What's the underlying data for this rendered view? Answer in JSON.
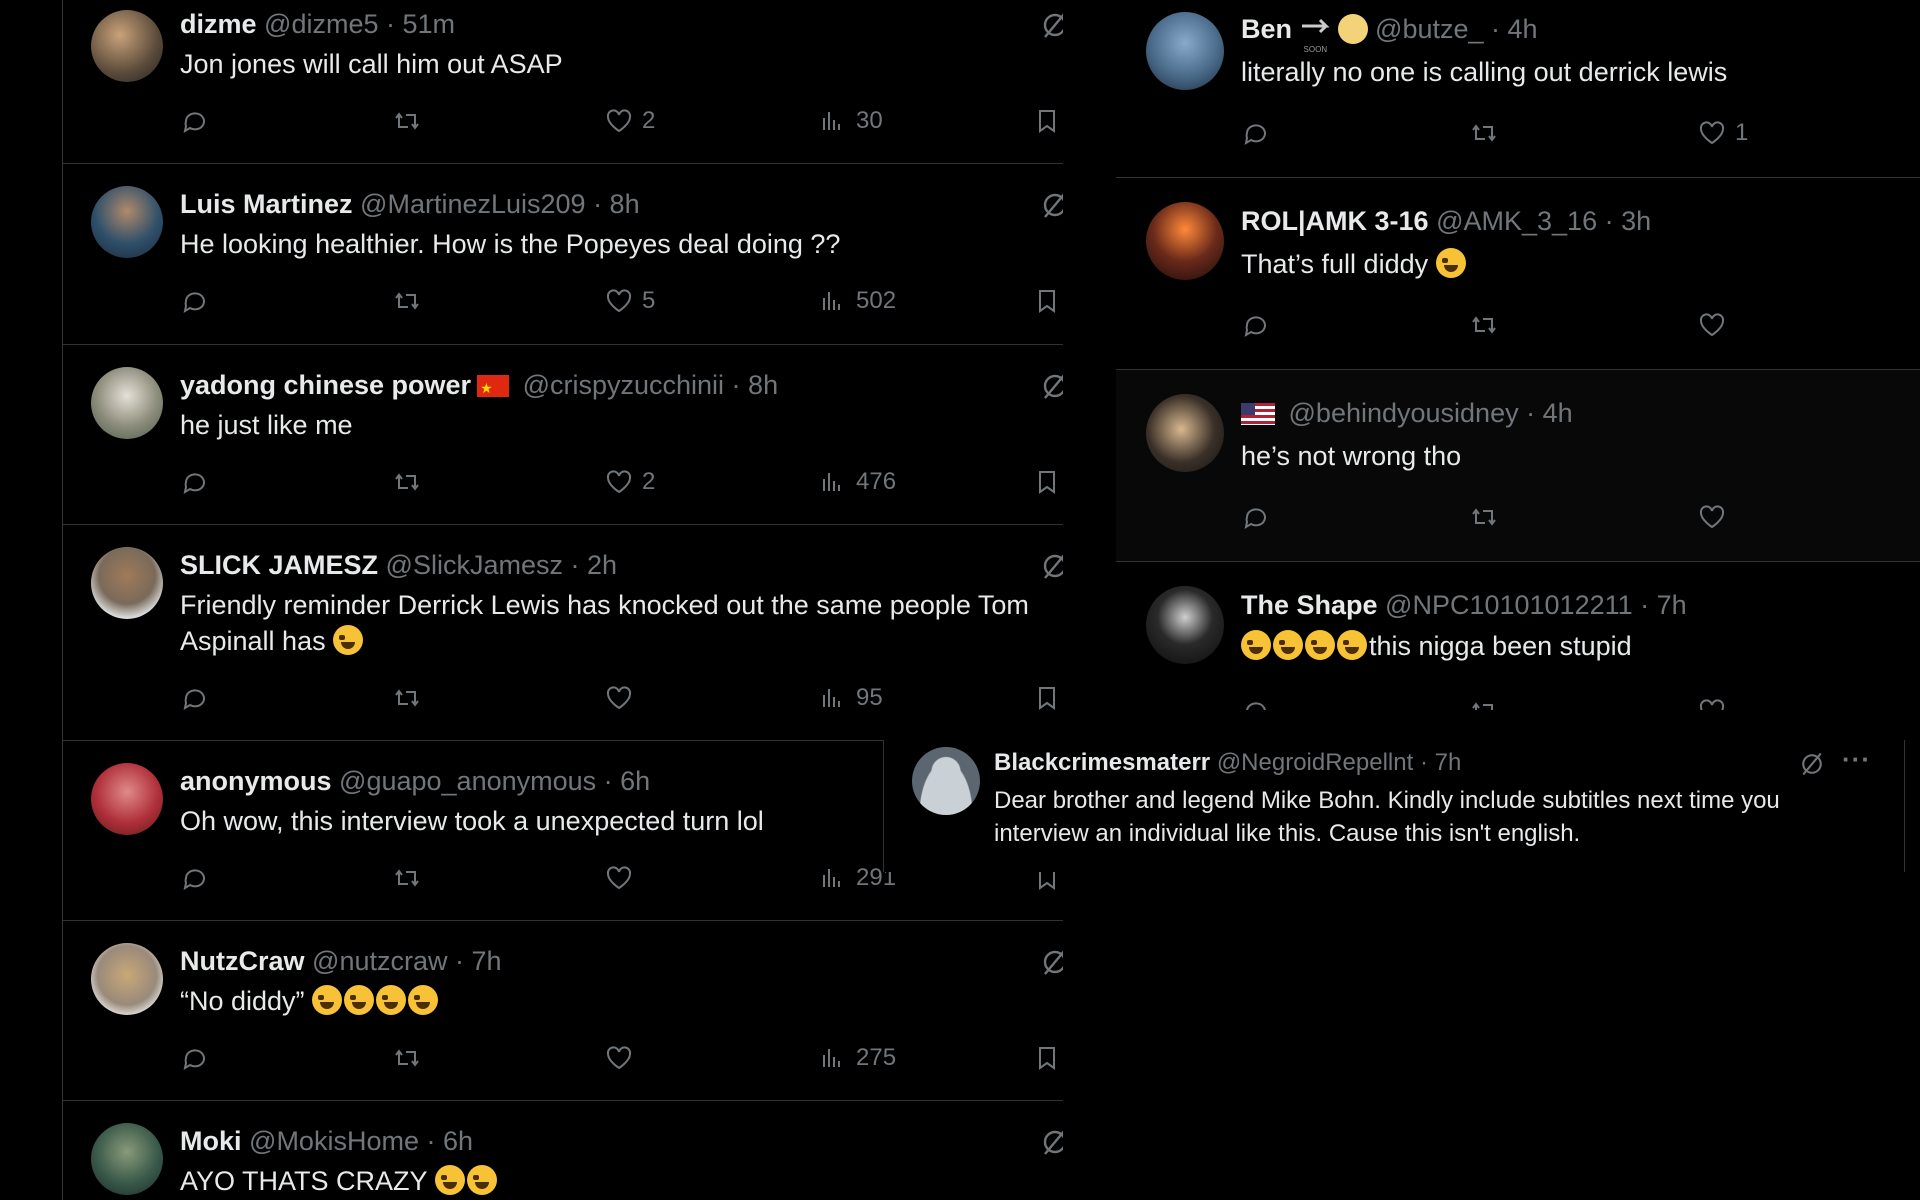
{
  "left_tweets": [
    {
      "name": "dizme",
      "handle": "@dizme5 · 51m",
      "text": "Jon jones will call him out ASAP",
      "likes": "2",
      "views": "30",
      "avatar_color": "#5a4a3a"
    },
    {
      "name": "Luis Martinez",
      "handle": "@MartinezLuis209 · 8h",
      "text": "He looking healthier. How is the Popeyes deal doing ??",
      "likes": "5",
      "views": "502",
      "avatar_color": "#2f4f6a"
    },
    {
      "name": "yadong chinese power",
      "handle": "@crispyzucchinii · 8h",
      "text": "he just like me",
      "likes": "2",
      "views": "476",
      "avatar_color": "#8c8c7a"
    },
    {
      "name": "SLICK JAMESZ",
      "handle": "@SlickJamesz · 2h",
      "text": "Friendly reminder Derrick Lewis has knocked out the same people Tom Aspinall has",
      "likes": "",
      "views": "95",
      "avatar_color": "#7a6a5a"
    },
    {
      "name": "anonymous",
      "handle": "@guapo_anonymous · 6h",
      "text": "Oh wow, this interview took a unexpected turn lol",
      "likes": "",
      "views": "291",
      "avatar_color": "#b0303a"
    },
    {
      "name": "NutzCraw",
      "handle": "@nutzcraw · 7h",
      "text": "“No diddy”",
      "likes": "",
      "views": "275",
      "avatar_color": "#9a8a7a"
    },
    {
      "name": "Moki",
      "handle": "@MokisHome · 6h",
      "text": "AYO THATS CRAZY",
      "avatar_color": "#3a5a4a"
    }
  ],
  "right_tweets": [
    {
      "name": "Ben",
      "handle": "@butze_ · 4h",
      "badge": "SOON",
      "text": "literally no one is calling out derrick lewis",
      "likes": "1",
      "avatar_color": "#4a6a8a"
    },
    {
      "name": "ROL|AMK 3-16",
      "handle": "@AMK_3_16 · 3h",
      "text": "That’s full diddy",
      "avatar_color": "#6a2a1a"
    },
    {
      "name": "",
      "handle": "@behindyousidney · 4h",
      "text": "he’s not wrong tho",
      "avatar_color": "#3a3028"
    },
    {
      "name": "The Shape",
      "handle": "@NPC10101012211 · 7h",
      "text": "this nigga been stupid",
      "avatar_color": "#2a2a2a"
    }
  ],
  "overlay_tweet": {
    "name": "Blackcrimesmaterr",
    "handle": "@NegroidRepellnt · 7h",
    "text": "Dear brother and legend Mike Bohn. Kindly include subtitles next time you interview an individual like this. Cause this isn't english."
  },
  "colors": {
    "background": "#000000",
    "text": "#e7e9ea",
    "muted": "#71767b",
    "divider": "#2f3336",
    "highlight": "#080808"
  },
  "icons": [
    "reply-icon",
    "retweet-icon",
    "like-icon",
    "views-icon",
    "bookmark-icon",
    "share-icon",
    "grok-icon",
    "more-icon"
  ]
}
